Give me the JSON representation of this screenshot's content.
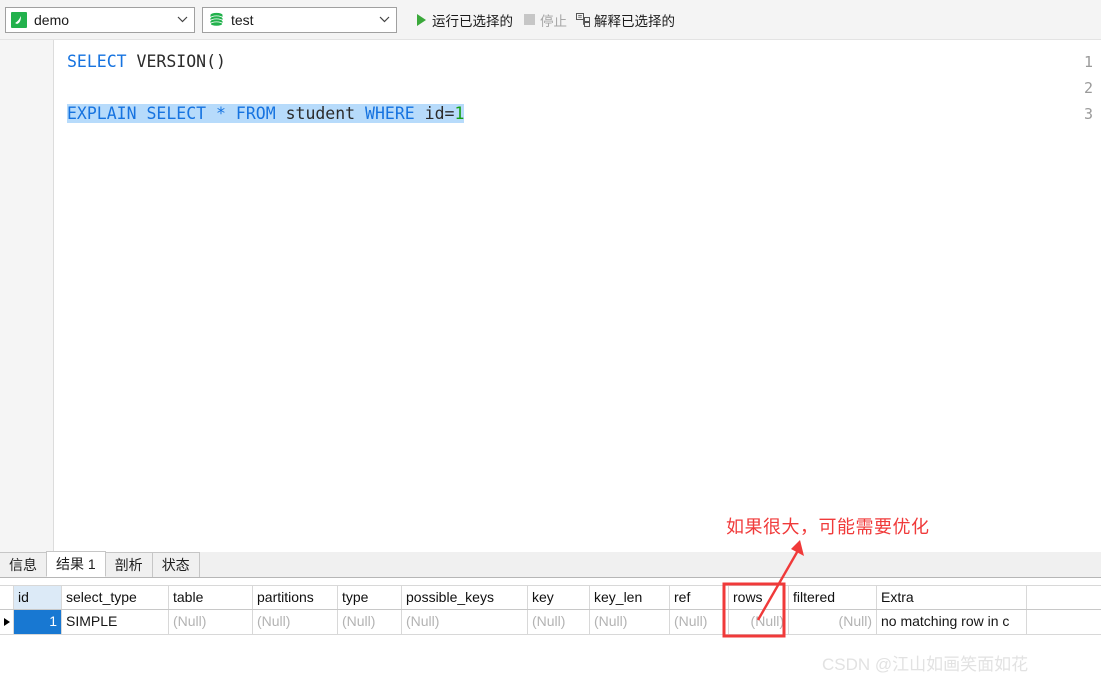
{
  "toolbar": {
    "connection": {
      "label": "demo",
      "icon": "connection-icon"
    },
    "schema": {
      "label": "test",
      "icon": "database-icon"
    },
    "run_selected": {
      "label": "运行已选择的",
      "icon": "play-icon"
    },
    "stop": {
      "label": "停止",
      "icon": "stop-icon",
      "disabled": true
    },
    "explain_selected": {
      "label": "解释已选择的",
      "icon": "explain-icon"
    }
  },
  "editor": {
    "line_numbers": [
      "1",
      "2",
      "3"
    ],
    "line1": {
      "keyword": "SELECT",
      "rest": " VERSION()"
    },
    "line3": {
      "k1": "EXPLAIN SELECT",
      "star": " * ",
      "k2": "FROM",
      "ident1": " student ",
      "k3": "WHERE",
      "ident2": " id=",
      "number": "1"
    }
  },
  "results": {
    "tabs": [
      {
        "label": "信息",
        "active": false
      },
      {
        "label": "结果 1",
        "active": true
      },
      {
        "label": "剖析",
        "active": false
      },
      {
        "label": "状态",
        "active": false
      }
    ],
    "columns": [
      "id",
      "select_type",
      "table",
      "partitions",
      "type",
      "possible_keys",
      "key",
      "key_len",
      "ref",
      "rows",
      "filtered",
      "Extra"
    ],
    "row": {
      "id": "1",
      "select_type": "SIMPLE",
      "table": "(Null)",
      "partitions": "(Null)",
      "type": "(Null)",
      "possible_keys": "(Null)",
      "key": "(Null)",
      "key_len": "(Null)",
      "ref": "(Null)",
      "rows": "(Null)",
      "filtered": "(Null)",
      "Extra": "no matching row in c"
    }
  },
  "annotation": {
    "text": "如果很大，可能需要优化",
    "color": "#f03a3a",
    "highlight_column": "rows"
  },
  "watermark": {
    "text": "CSDN @江山如画笑面如花"
  },
  "colors": {
    "accent_green": "#22b14c",
    "keyword_blue": "#1673e0",
    "number_green": "#15a015",
    "selection_blue": "#b7dbfb",
    "selected_cell": "#1878d2",
    "annotation_red": "#f03a3a"
  }
}
